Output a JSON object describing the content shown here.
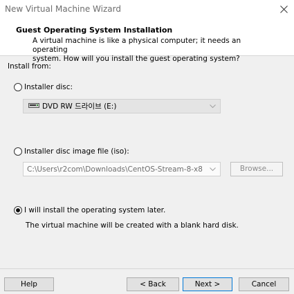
{
  "window": {
    "title": "New Virtual Machine Wizard"
  },
  "header": {
    "title": "Guest Operating System Installation",
    "description_line1": "A virtual machine is like a physical computer; it needs an operating",
    "description_line2": "system. How will you install the guest operating system?"
  },
  "install_from_label": "Install from:",
  "options": {
    "installer_disc": {
      "label": "Installer disc:",
      "selected": false,
      "drive_value": "DVD RW 드라이브 (E:)"
    },
    "iso_file": {
      "label": "Installer disc image file (iso):",
      "selected": false,
      "path_value": "C:\\Users\\r2com\\Downloads\\CentOS-Stream-8-x8",
      "browse_label": "Browse..."
    },
    "install_later": {
      "label": "I will install the operating system later.",
      "selected": true,
      "info": "The virtual machine will be created with a blank hard disk."
    }
  },
  "buttons": {
    "help": "Help",
    "back": "< Back",
    "next": "Next >",
    "cancel": "Cancel"
  }
}
